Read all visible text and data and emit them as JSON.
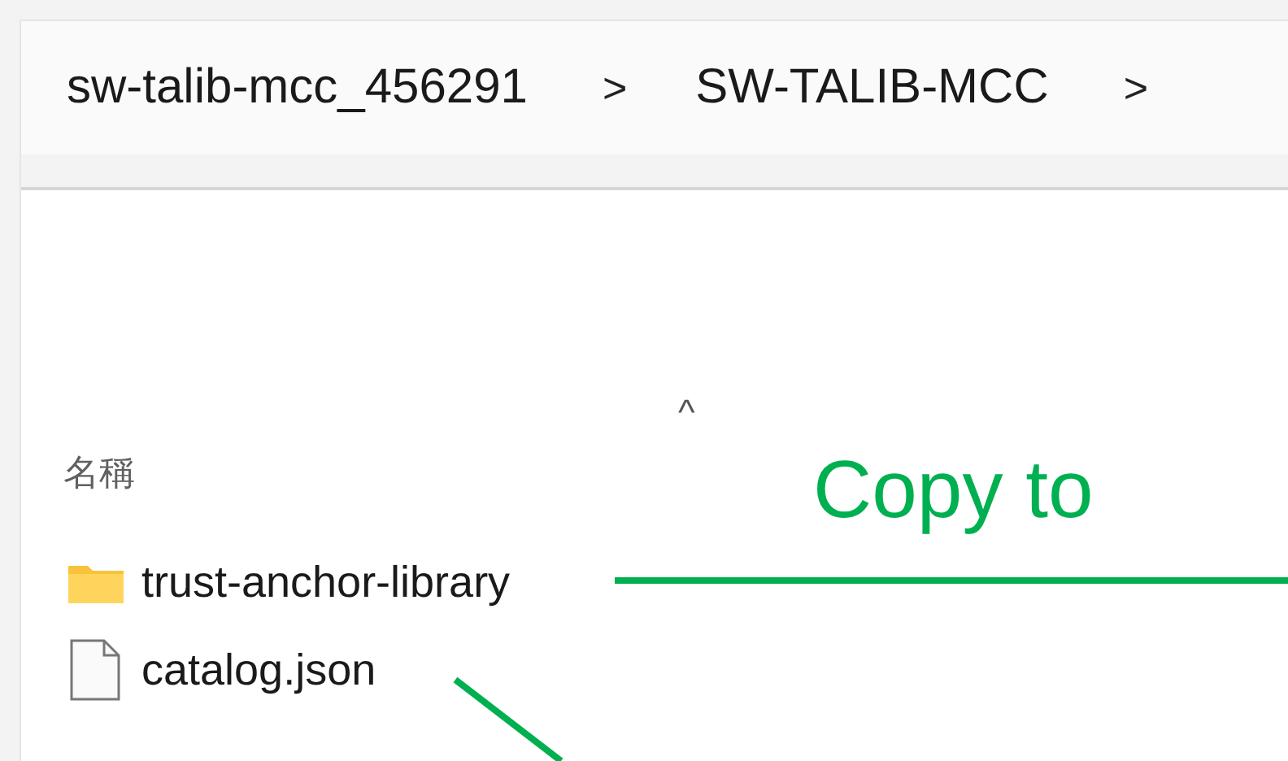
{
  "breadcrumb": [
    {
      "label": "sw-talib-mcc_456291",
      "separator": ">"
    },
    {
      "label": "SW-TALIB-MCC",
      "separator": ">"
    }
  ],
  "column_header": {
    "label": "名稱",
    "sort_caret": "^"
  },
  "files": [
    {
      "name": "trust-anchor-library",
      "kind": "folder"
    },
    {
      "name": "catalog.json",
      "kind": "file"
    }
  ],
  "annotation": {
    "label": "Copy to",
    "color": "#00b050"
  }
}
